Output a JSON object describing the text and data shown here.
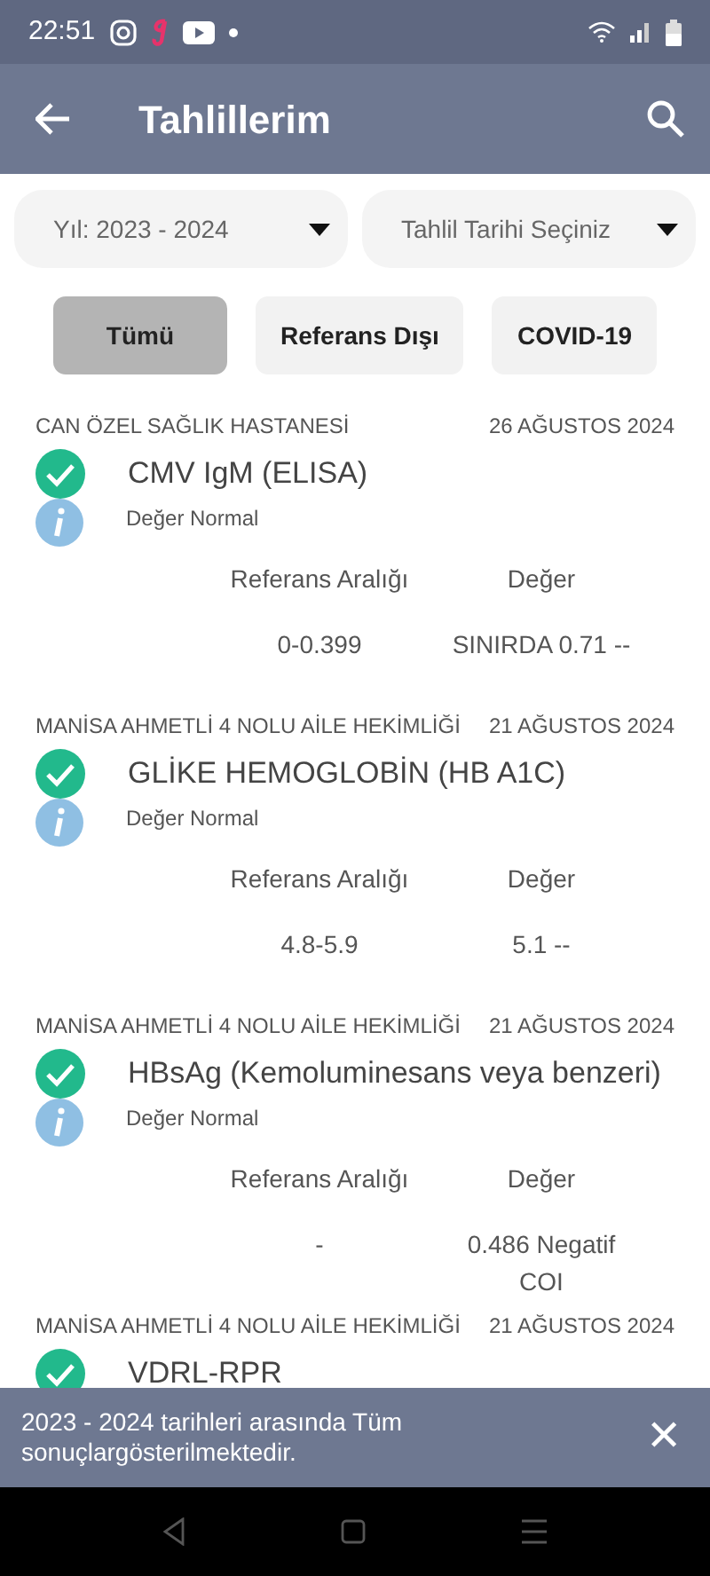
{
  "status_bar": {
    "time": "22:51"
  },
  "app_bar": {
    "title": "Tahlillerim"
  },
  "filters": [
    {
      "label": "Yıl: 2023 - 2024"
    },
    {
      "label": "Tahlil Tarihi Seçiniz"
    }
  ],
  "chips": [
    {
      "label": "Tümü",
      "selected": true
    },
    {
      "label": "Referans Dışı",
      "selected": false
    },
    {
      "label": "COVID-19",
      "selected": false
    }
  ],
  "results": [
    {
      "facility": "CAN ÖZEL SAĞLIK HASTANESİ",
      "date": "26 AĞUSTOS 2024",
      "normal": true,
      "test": "CMV IgM (ELISA)",
      "note": "Değer Normal",
      "ref_label": "Referans Aralığı",
      "value_label": "Değer",
      "ref": "0-0.399",
      "value": "SINIRDA 0.71 --"
    },
    {
      "facility": "MANİSA AHMETLİ 4 NOLU AİLE HEKİMLİĞİ",
      "date": "21 AĞUSTOS 2024",
      "normal": true,
      "test": "GLİKE HEMOGLOBİN (HB A1C)",
      "note": "Değer Normal",
      "ref_label": "Referans Aralığı",
      "value_label": "Değer",
      "ref": "4.8-5.9",
      "value": "5.1 --"
    },
    {
      "facility": "MANİSA AHMETLİ 4 NOLU AİLE HEKİMLİĞİ",
      "date": "21 AĞUSTOS 2024",
      "normal": true,
      "test": "HBsAg (Kemoluminesans veya benzeri)",
      "note": "Değer Normal",
      "ref_label": "Referans Aralığı",
      "value_label": "Değer",
      "ref": "-",
      "value": "0.486 Negatif COI"
    },
    {
      "facility": "MANİSA AHMETLİ 4 NOLU AİLE HEKİMLİĞİ",
      "date": "21 AĞUSTOS 2024",
      "normal": true,
      "test": "VDRL-RPR"
    }
  ],
  "snackbar": {
    "message": "2023 - 2024 tarihleri arasında Tüm sonuçlargösterilmektedir.",
    "close": "✕"
  }
}
